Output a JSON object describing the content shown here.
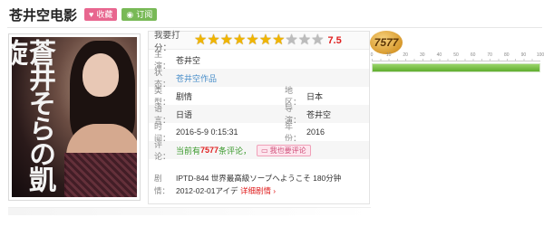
{
  "header": {
    "title": "苍井空电影",
    "fav_label": "收藏",
    "sub_label": "订阅"
  },
  "poster": {
    "title_text": "蒼井そらの凱旋"
  },
  "rating": {
    "label": "我要打分：",
    "stars_total": 10,
    "stars_on": 7,
    "score": "7.5"
  },
  "details": {
    "actor_label": "主演：",
    "actor": "苍井空",
    "status_label": "状态：",
    "status": "苍井空作品",
    "type_label": "类型：",
    "type": "剧情",
    "region_label": "地区：",
    "region": "日本",
    "lang_label": "语言：",
    "lang": "日语",
    "director_label": "导演：",
    "director": "苍井空",
    "time_label": "时间：",
    "time": "2016-5-9 0:15:31",
    "year_label": "年份：",
    "year": "2016",
    "comment_label": "评论：",
    "comment_prefix": "当前有",
    "comment_count": "7577",
    "comment_suffix": "条评论，",
    "comment_button": "我也要评论",
    "plot_label": "剧情：",
    "plot": "IPTD-844 世界最高級ソープへようこそ 180分钟 2012-02-01アイデ",
    "plot_more": "详细剧情 ›"
  },
  "gauge": {
    "badge": "7577",
    "scale": [
      "0",
      "10",
      "20",
      "30",
      "40",
      "50",
      "60",
      "70",
      "80",
      "90",
      "100"
    ],
    "level_fraction": 1.0
  },
  "colors": {
    "accent_red": "#e02020",
    "fav_pink": "#e8668f",
    "sub_green": "#78b956",
    "star_gold": "#f0b500"
  },
  "icons": [
    "heart-icon",
    "rss-icon",
    "star-icon",
    "comment-icon"
  ]
}
